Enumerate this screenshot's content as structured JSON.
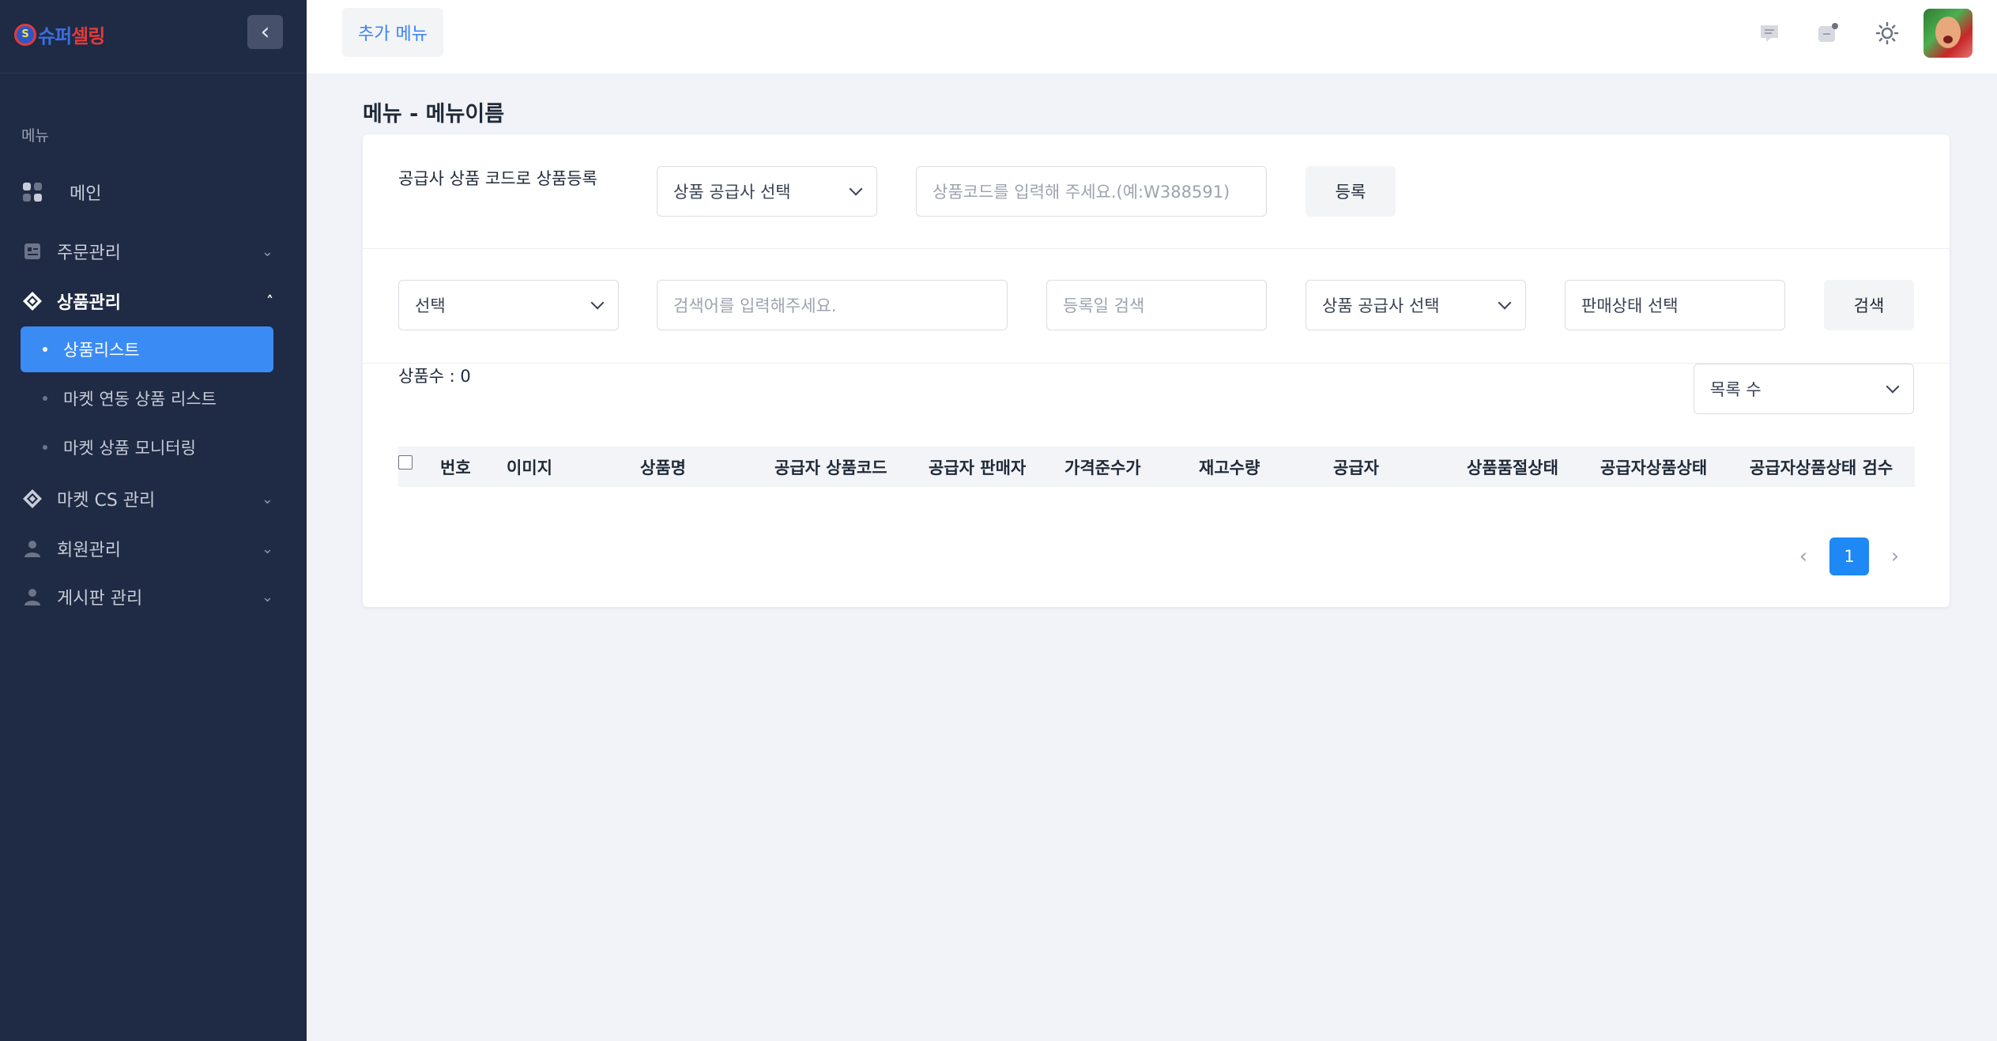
{
  "brand": {
    "logo_mark": "S",
    "logo_text_a": "슈퍼",
    "logo_text_b": "셀링"
  },
  "sidebar": {
    "collapse_icon": "chevron-left-icon",
    "section_label": "메뉴",
    "items": [
      {
        "label": "메인",
        "icon": "grid-icon"
      },
      {
        "label": "주문관리",
        "icon": "clipboard-icon"
      },
      {
        "label": "상품관리",
        "icon": "box-icon"
      },
      {
        "label": "마켓 CS 관리",
        "icon": "box-icon"
      },
      {
        "label": "회원관리",
        "icon": "user-icon"
      },
      {
        "label": "게시판 관리",
        "icon": "user-icon"
      }
    ],
    "subitems": [
      {
        "label": "상품리스트"
      },
      {
        "label": "마켓 연동 상품 리스트"
      },
      {
        "label": "마켓 상품 모니터링"
      }
    ]
  },
  "topbar": {
    "extra_menu": "추가 메뉴",
    "icons": [
      "message-icon",
      "notification-icon",
      "theme-sun-icon"
    ]
  },
  "page": {
    "title": "메뉴 - 메뉴이름"
  },
  "register": {
    "label": "공급사 상품 코드로 상품등록",
    "supplier_select": "상품 공급사 선택",
    "code_placeholder": "상품코드를 입력해 주세요.(예:W388591)",
    "submit": "등록"
  },
  "filters": {
    "category_select": "선택",
    "keyword_placeholder": "검색어를 입력해주세요.",
    "date_placeholder": "등록일 검색",
    "supplier_select": "상품 공급사 선택",
    "status_placeholder": "판매상태 선택",
    "search": "검색"
  },
  "list": {
    "count_label": "상품수 : 0",
    "page_size_select": "목록 수"
  },
  "table": {
    "columns": [
      "번호",
      "이미지",
      "상품명",
      "공급자 상품코드",
      "공급자 판매자",
      "가격준수가",
      "재고수량",
      "공급자",
      "상품품절상태",
      "공급자상품상태",
      "공급자상품상태 검수"
    ]
  },
  "pagination": {
    "prev": "‹",
    "current": "1",
    "next": "›"
  },
  "colors": {
    "sidebar": "#1f2a44",
    "accent": "#3b8bf5",
    "page_button": "#1e88f5"
  }
}
